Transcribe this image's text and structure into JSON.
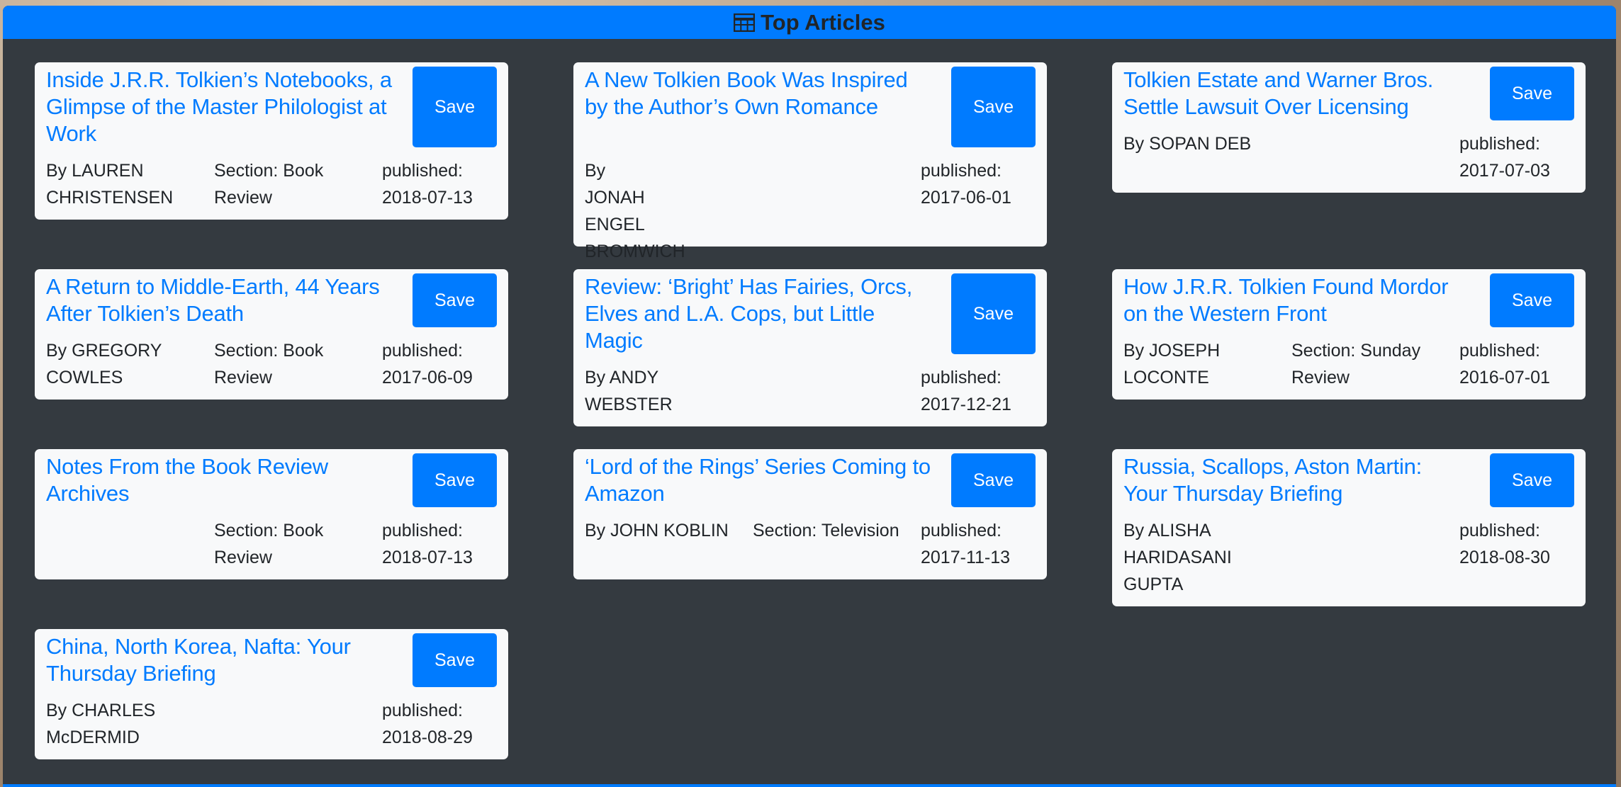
{
  "header": {
    "title": "Top Articles",
    "icon": "table-icon"
  },
  "save_label": "Save",
  "colors": {
    "accent": "#007bff",
    "panel": "#343a40",
    "card": "#f8f9fa"
  },
  "articles": [
    {
      "title": "Inside J.R.R. Tolkien’s Notebooks, a Glimpse of the Master Philologist at Work",
      "byline": "By LAUREN CHRISTENSEN",
      "section": "Section: Book Review",
      "published": "published: 2018-07-13"
    },
    {
      "title": "A New Tolkien Book Was Inspired by the Author’s Own Romance",
      "byline": "By JONAH ENGEL BROMWICH",
      "section": "",
      "published": "published: 2017-06-01"
    },
    {
      "title": "Tolkien Estate and Warner Bros. Settle Lawsuit Over Licensing",
      "byline": "By SOPAN DEB",
      "section": "",
      "published": "published: 2017-07-03"
    },
    {
      "title": "A Return to Middle-Earth, 44 Years After Tolkien’s Death",
      "byline": "By GREGORY COWLES",
      "section": "Section: Book Review",
      "published": "published: 2017-06-09"
    },
    {
      "title": "Review: ‘Bright’ Has Fairies, Orcs, Elves and L.A. Cops, but Little Magic",
      "byline": "By ANDY WEBSTER",
      "section": "",
      "published": "published: 2017-12-21"
    },
    {
      "title": "How J.R.R. Tolkien Found Mordor on the Western Front",
      "byline": "By JOSEPH LOCONTE",
      "section": "Section: Sunday Review",
      "published": "published: 2016-07-01"
    },
    {
      "title": "Notes From the Book Review Archives",
      "byline": "",
      "section": "Section: Book Review",
      "published": "published: 2018-07-13"
    },
    {
      "title": "‘Lord of the Rings’ Series Coming to Amazon",
      "byline": "By JOHN KOBLIN",
      "section": "Section: Television",
      "published": "published: 2017-11-13"
    },
    {
      "title": "Russia, Scallops, Aston Martin: Your Thursday Briefing",
      "byline": "By ALISHA HARIDASANI GUPTA",
      "section": "",
      "published": "published: 2018-08-30"
    },
    {
      "title": "China, North Korea, Nafta: Your Thursday Briefing",
      "byline": "By CHARLES McDERMID",
      "section": "",
      "published": "published: 2018-08-29"
    }
  ]
}
